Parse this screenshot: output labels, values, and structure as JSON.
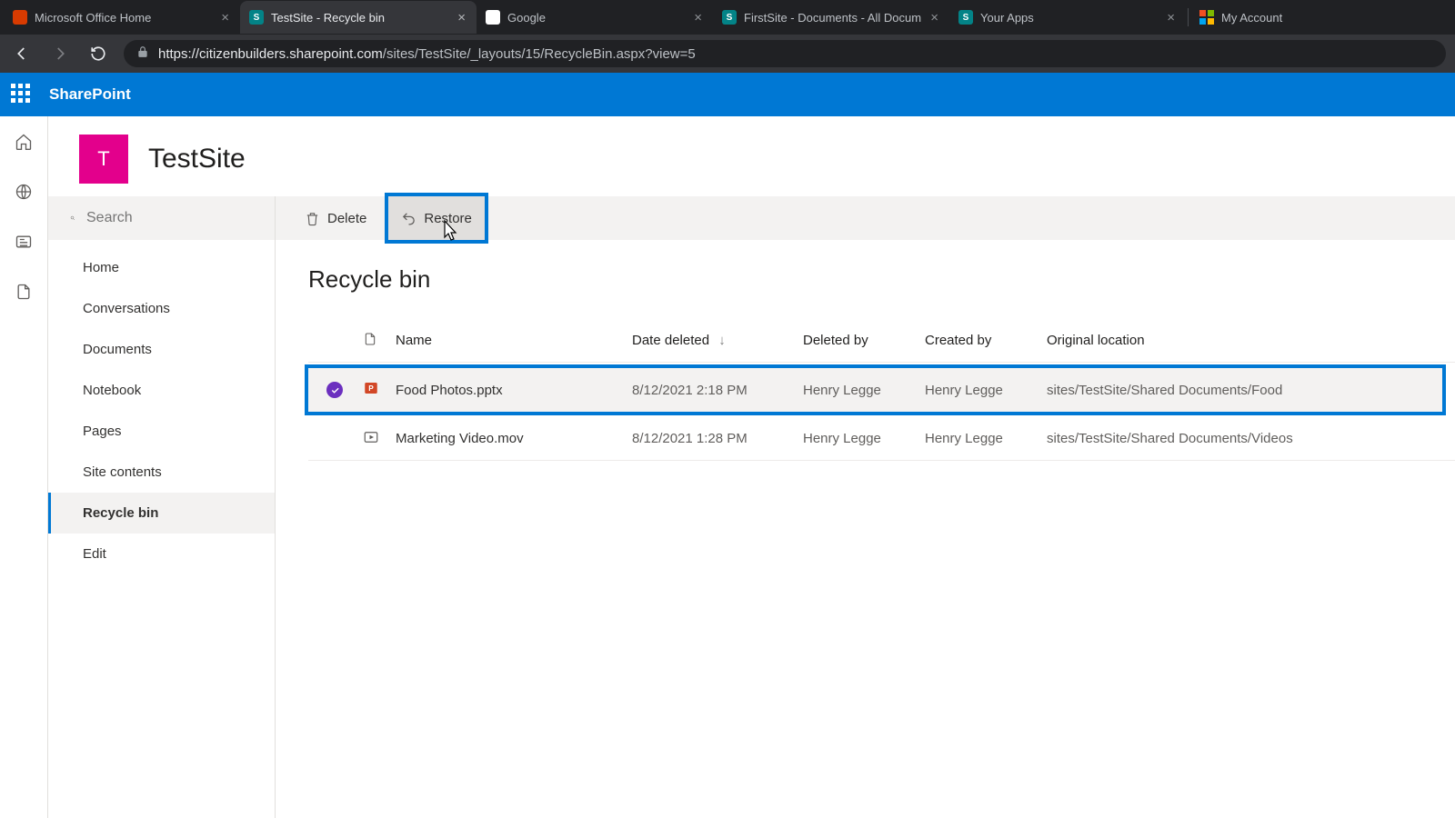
{
  "browser": {
    "tabs": [
      {
        "title": "Microsoft Office Home",
        "favClass": "fav-office",
        "favLetter": ""
      },
      {
        "title": "TestSite - Recycle bin",
        "favClass": "fav-sp",
        "favLetter": "S",
        "active": true
      },
      {
        "title": "Google",
        "favClass": "fav-google",
        "favLetter": "G"
      },
      {
        "title": "FirstSite - Documents - All Docum",
        "favClass": "fav-sp",
        "favLetter": "S"
      },
      {
        "title": "Your Apps",
        "favClass": "fav-sp",
        "favLetter": "S"
      },
      {
        "title": "My Account",
        "favClass": "fav-ms",
        "favLetter": ""
      }
    ],
    "url_host": "https://citizenbuilders.sharepoint.com",
    "url_path": "/sites/TestSite/_layouts/15/RecycleBin.aspx?view=5"
  },
  "suite": {
    "product": "SharePoint"
  },
  "site": {
    "logo_letter": "T",
    "title": "TestSite"
  },
  "search": {
    "placeholder": "Search"
  },
  "cmdbar": {
    "delete": "Delete",
    "restore": "Restore"
  },
  "leftnav": {
    "items": [
      "Home",
      "Conversations",
      "Documents",
      "Notebook",
      "Pages",
      "Site contents",
      "Recycle bin",
      "Edit"
    ],
    "active_index": 6
  },
  "page": {
    "title": "Recycle bin"
  },
  "columns": {
    "name": "Name",
    "date_deleted": "Date deleted",
    "deleted_by": "Deleted by",
    "created_by": "Created by",
    "original_location": "Original location"
  },
  "rows": [
    {
      "selected": true,
      "icon": "pptx",
      "name": "Food Photos.pptx",
      "date_deleted": "8/12/2021 2:18 PM",
      "deleted_by": "Henry Legge",
      "created_by": "Henry Legge",
      "original_location": "sites/TestSite/Shared Documents/Food"
    },
    {
      "selected": false,
      "icon": "video",
      "name": "Marketing Video.mov",
      "date_deleted": "8/12/2021 1:28 PM",
      "deleted_by": "Henry Legge",
      "created_by": "Henry Legge",
      "original_location": "sites/TestSite/Shared Documents/Videos"
    }
  ]
}
